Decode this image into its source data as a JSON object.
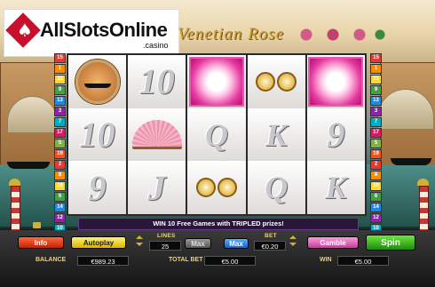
{
  "watermark": {
    "brand": "AllSlotsOnline",
    "suffix": ".casino"
  },
  "game": {
    "title": "Venetian Rose"
  },
  "paylines_left": [
    "15",
    "1",
    "11",
    "9",
    "13",
    "3",
    "7",
    "17",
    "5",
    "19",
    "2",
    "8",
    "16",
    "6",
    "14",
    "12",
    "10",
    "4",
    "20",
    "18"
  ],
  "paylines_right": [
    "15",
    "1",
    "11",
    "9",
    "13",
    "3",
    "7",
    "17",
    "5",
    "19",
    "2",
    "8",
    "16",
    "6",
    "14",
    "12",
    "10",
    "4",
    "20",
    "18"
  ],
  "reels": [
    [
      "gondola",
      "10",
      "9"
    ],
    [
      "10",
      "fan",
      "J"
    ],
    [
      "rose",
      "Q",
      "binoculars"
    ],
    [
      "binoculars",
      "K",
      "Q"
    ],
    [
      "rose",
      "9",
      "K"
    ]
  ],
  "info_message": "WIN 10 Free Games with TRIPLED prizes!",
  "controls": {
    "info_label": "Info",
    "autoplay_label": "Autoplay",
    "lines_label": "LINES",
    "lines_value": "25",
    "max_lines_label": "Max",
    "max_bet_label": "Max",
    "bet_label": "BET",
    "bet_value": "€0.20",
    "gamble_label": "Gamble",
    "spin_label": "Spin"
  },
  "status": {
    "balance_label": "BALANCE",
    "balance_value": "€989.23",
    "total_bet_label": "TOTAL BET",
    "total_bet_value": "€5.00",
    "win_label": "WIN",
    "win_value": "€5.00"
  },
  "colors": {
    "accent": "#d4af37",
    "panel": "#151515",
    "reel_border": "#2a2a2a"
  }
}
